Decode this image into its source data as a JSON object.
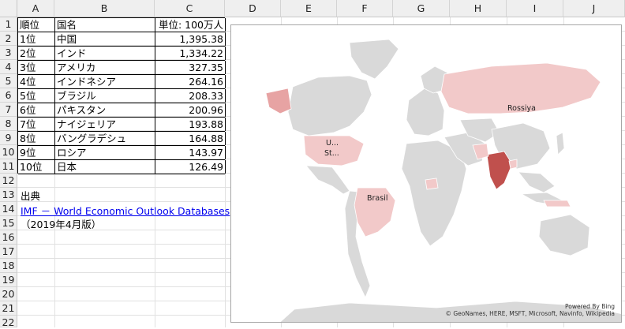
{
  "spreadsheet": {
    "columns": [
      "A",
      "B",
      "C",
      "D",
      "E",
      "F",
      "G",
      "H",
      "I",
      "J"
    ],
    "rows": [
      "1",
      "2",
      "3",
      "4",
      "5",
      "6",
      "7",
      "8",
      "9",
      "10",
      "11",
      "12",
      "13",
      "14",
      "15",
      "16",
      "17",
      "18",
      "19",
      "20",
      "21",
      "22"
    ]
  },
  "table": {
    "header": {
      "rank": "順位",
      "country": "国名",
      "unit": "単位: 100万人"
    },
    "rows": [
      {
        "rank": "1位",
        "country": "中国",
        "value": "1,395.38"
      },
      {
        "rank": "2位",
        "country": "インド",
        "value": "1,334.22"
      },
      {
        "rank": "3位",
        "country": "アメリカ",
        "value": "327.35"
      },
      {
        "rank": "4位",
        "country": "インドネシア",
        "value": "264.16"
      },
      {
        "rank": "5位",
        "country": "ブラジル",
        "value": "208.33"
      },
      {
        "rank": "6位",
        "country": "パキスタン",
        "value": "200.96"
      },
      {
        "rank": "7位",
        "country": "ナイジェリア",
        "value": "193.88"
      },
      {
        "rank": "8位",
        "country": "バングラデシュ",
        "value": "164.88"
      },
      {
        "rank": "9位",
        "country": "ロシア",
        "value": "143.97"
      },
      {
        "rank": "10位",
        "country": "日本",
        "value": "126.49"
      }
    ]
  },
  "source": {
    "label": "出典",
    "link_text": "IMF － World Economic Outlook Databases",
    "note": "（2019年4月版）"
  },
  "map": {
    "labels": {
      "russia": "Rossiya",
      "us1": "U...",
      "us2": "St...",
      "brazil": "Brasil"
    },
    "attribution_line1": "Powered By Bing",
    "attribution_line2": "© GeoNames, HERE, MSFT, Microsoft, Navinfo, Wikipedia",
    "colors": {
      "base": "#d9d9d9",
      "light": "#f2c9c9",
      "mid": "#e7a3a3",
      "strong": "#c0504d"
    }
  }
}
